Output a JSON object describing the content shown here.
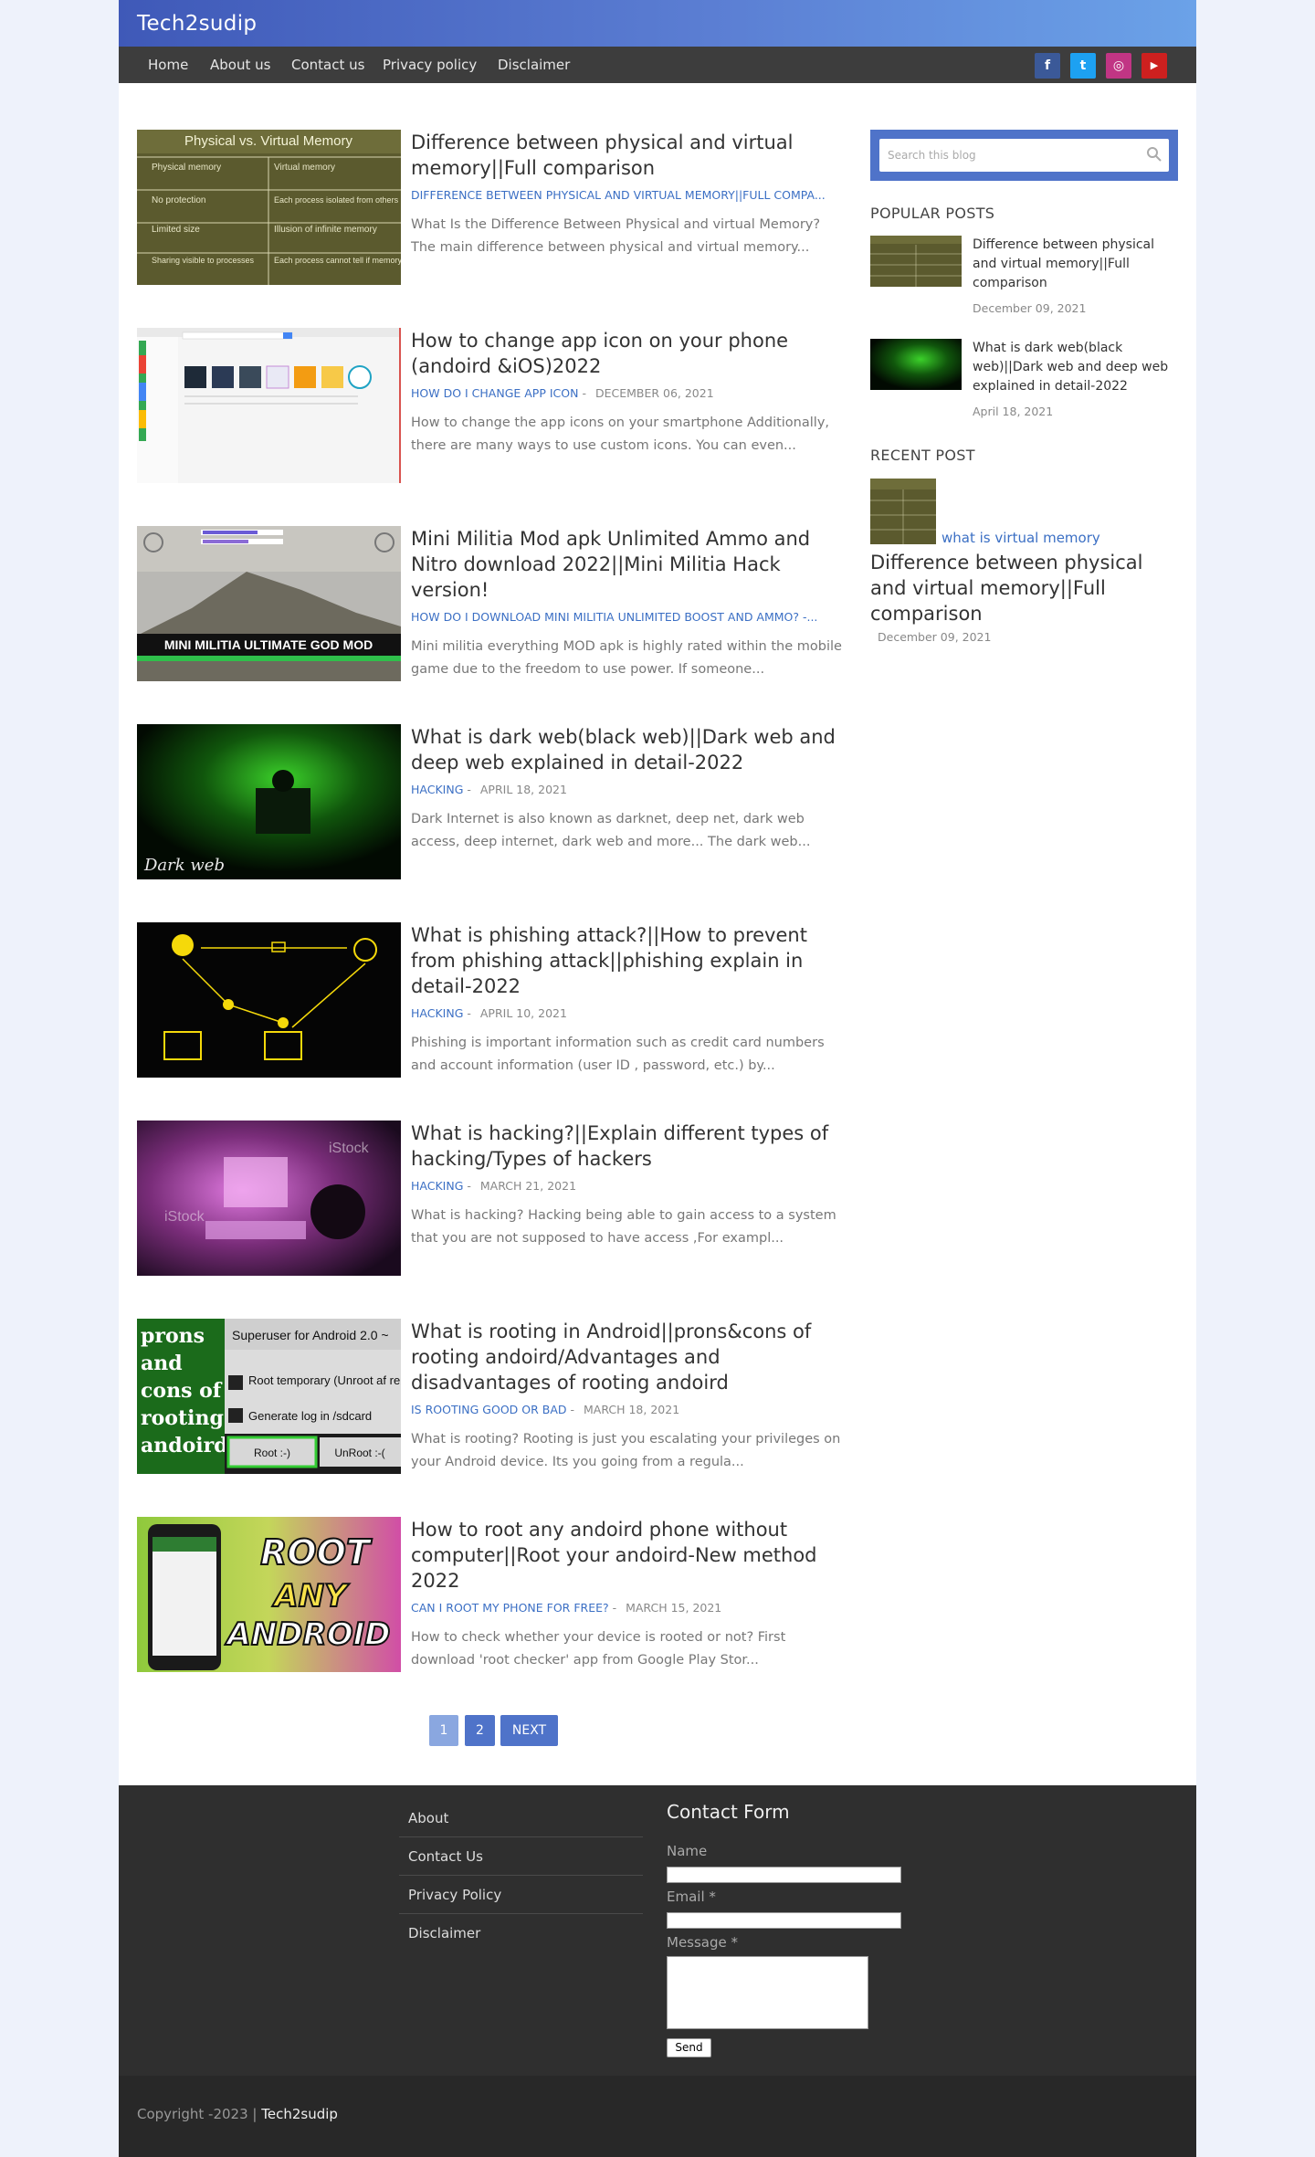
{
  "site": {
    "title": "Tech2sudip"
  },
  "nav": {
    "items": [
      "Home",
      "About us",
      "Contact us",
      "Privacy policy",
      "Disclaimer"
    ]
  },
  "social": [
    {
      "icon": "facebook-icon",
      "glyph": "f",
      "color": "#3b5998"
    },
    {
      "icon": "twitter-icon",
      "glyph": "t",
      "color": "#1da1f2"
    },
    {
      "icon": "instagram-icon",
      "glyph": "◎",
      "color": "#c13584"
    },
    {
      "icon": "youtube-icon",
      "glyph": "▶",
      "color": "#cd201f"
    }
  ],
  "posts": [
    {
      "title": "Difference between physical and virtual memory||Full comparison",
      "label": "DIFFERENCE BETWEEN PHYSICAL AND VIRTUAL MEMORY||FULL COMPA...",
      "date": "",
      "snippet": "What Is the Difference Between Physical and virtual Memory? The main difference between physical and virtual memory..."
    },
    {
      "title": "How to change app icon on your phone (andoird &iOS)2022",
      "label": "HOW DO I CHANGE APP ICON",
      "date": "DECEMBER 06, 2021",
      "snippet": "How to change the app icons on your smartphone Additionally, there are many ways to use custom icons. You can even..."
    },
    {
      "title": "Mini Militia Mod apk Unlimited Ammo and Nitro download 2022||Mini Militia Hack version!",
      "label": "HOW DO I DOWNLOAD MINI MILITIA UNLIMITED BOOST AND AMMO? -...",
      "date": "",
      "snippet": "Mini militia everything MOD apk is highly rated within the mobile game due to the freedom to use power. If someone..."
    },
    {
      "title": "What is dark web(black web)||Dark web and deep web explained in detail-2022",
      "label": "HACKING",
      "date": "APRIL 18, 2021",
      "snippet": "Dark Internet is also known as darknet, deep net, dark web access, deep internet, dark web and more... The dark web..."
    },
    {
      "title": "What is phishing attack?||How to prevent from phishing attack||phishing explain in detail-2022",
      "label": "HACKING",
      "date": "APRIL 10, 2021",
      "snippet": "Phishing is important information such as credit card numbers and account information (user ID , password, etc.) by..."
    },
    {
      "title": "What is hacking?||Explain different types of hacking/Types of hackers",
      "label": "HACKING",
      "date": "MARCH 21, 2021",
      "snippet": "What is hacking? Hacking being able to gain access to a system that you are not supposed to have access ,For exampl..."
    },
    {
      "title": "What is rooting in Android||prons&cons of rooting andoird/Advantages and disadvantages of rooting andoird",
      "label": "IS ROOTING GOOD OR BAD",
      "date": "MARCH 18, 2021",
      "snippet": "What is rooting? Rooting is just you escalating your privileges on your Android device. Its you going from a regula..."
    },
    {
      "title": "How to root any andoird phone without computer||Root your andoird-New method 2022",
      "label": "CAN I ROOT MY PHONE FOR FREE?",
      "date": "MARCH 15, 2021",
      "snippet": "How to check whether your device is rooted or not? First download 'root checker' app from Google Play Stor..."
    }
  ],
  "thumb_text": {
    "mem_title": "Physical vs. Virtual Memory",
    "mem_rows": [
      [
        "Physical memory",
        "Virtual memory"
      ],
      [
        "No protection",
        "Each process isolated from others and from OS"
      ],
      [
        "Limited size",
        "Illusion of infinite memory"
      ],
      [
        "Sharing visible to processes",
        "Each process cannot tell if memory is shared"
      ]
    ],
    "mm_banner": "MINI MILITIA ULTIMATE GOD MOD",
    "dark_caption": "Dark web",
    "root_side": "prons and cons of rooting andoird",
    "root_panel": "Superuser for Android 2.0 ~",
    "root_opt1": "Root temporary (Unroot af reboot)",
    "root_opt2": "Generate log in /sdcard",
    "root_btn1": "Root :-)",
    "root_btn2": "UnRoot :-(",
    "root_any": [
      "ROOT",
      "ANY",
      "ANDROID"
    ],
    "istock": "iStock"
  },
  "pagination": {
    "pages": [
      "1",
      "2"
    ],
    "next": "NEXT"
  },
  "sidebar": {
    "search_placeholder": "Search this blog",
    "popular_heading": "POPULAR POSTS",
    "popular": [
      {
        "title": "Difference between physical and virtual memory||Full comparison",
        "date": "December 09, 2021"
      },
      {
        "title": "What is dark web(black web)||Dark web and deep web explained in detail-2022",
        "date": "April 18, 2021"
      }
    ],
    "recent_heading": "RECENT POST",
    "recent": {
      "link": "what is virtual memory",
      "title": "Difference between physical and virtual memory||Full comparison",
      "date": "December 09, 2021"
    }
  },
  "footer": {
    "links": [
      "About",
      "Contact Us",
      "Privacy Policy",
      "Disclaimer"
    ],
    "form_title": "Contact Form",
    "name_label": "Name",
    "email_label": "Email *",
    "message_label": "Message *",
    "send": "Send",
    "copyright": "Copyright -2023 |",
    "copyright_site": "Tech2sudip"
  }
}
